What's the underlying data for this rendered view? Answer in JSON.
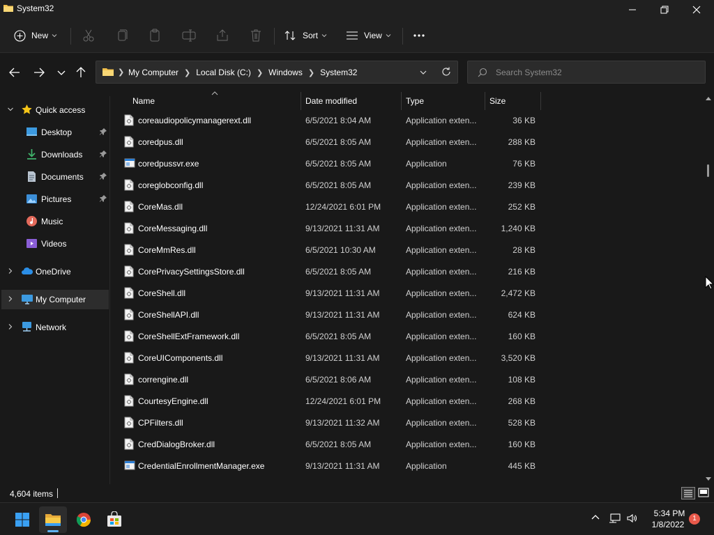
{
  "window": {
    "title": "System32"
  },
  "toolbar": {
    "new_label": "New",
    "sort_label": "Sort",
    "view_label": "View",
    "more_label": "..."
  },
  "address": {
    "crumbs": [
      "My Computer",
      "Local Disk (C:)",
      "Windows",
      "System32"
    ]
  },
  "search": {
    "placeholder": "Search System32"
  },
  "sidebar": {
    "items": [
      {
        "label": "Quick access",
        "icon": "star-icon"
      },
      {
        "label": "Desktop",
        "icon": "desktop-icon",
        "pinned": true
      },
      {
        "label": "Downloads",
        "icon": "download-icon",
        "pinned": true
      },
      {
        "label": "Documents",
        "icon": "documents-icon",
        "pinned": true
      },
      {
        "label": "Pictures",
        "icon": "pictures-icon",
        "pinned": true
      },
      {
        "label": "Music",
        "icon": "music-icon"
      },
      {
        "label": "Videos",
        "icon": "videos-icon"
      },
      {
        "label": "OneDrive",
        "icon": "cloud-icon"
      },
      {
        "label": "My Computer",
        "icon": "computer-icon",
        "selected": true
      },
      {
        "label": "Network",
        "icon": "network-icon"
      }
    ]
  },
  "columns": {
    "name": "Name",
    "date": "Date modified",
    "type": "Type",
    "size": "Size"
  },
  "files": [
    {
      "name": "coreaudiopolicymanagerext.dll",
      "date": "6/5/2021 8:04 AM",
      "type": "Application exten...",
      "size": "36 KB",
      "kind": "dll"
    },
    {
      "name": "coredpus.dll",
      "date": "6/5/2021 8:05 AM",
      "type": "Application exten...",
      "size": "288 KB",
      "kind": "dll"
    },
    {
      "name": "coredpussvr.exe",
      "date": "6/5/2021 8:05 AM",
      "type": "Application",
      "size": "76 KB",
      "kind": "exe"
    },
    {
      "name": "coreglobconfig.dll",
      "date": "6/5/2021 8:05 AM",
      "type": "Application exten...",
      "size": "239 KB",
      "kind": "dll"
    },
    {
      "name": "CoreMas.dll",
      "date": "12/24/2021 6:01 PM",
      "type": "Application exten...",
      "size": "252 KB",
      "kind": "dll"
    },
    {
      "name": "CoreMessaging.dll",
      "date": "9/13/2021 11:31 AM",
      "type": "Application exten...",
      "size": "1,240 KB",
      "kind": "dll"
    },
    {
      "name": "CoreMmRes.dll",
      "date": "6/5/2021 10:30 AM",
      "type": "Application exten...",
      "size": "28 KB",
      "kind": "dll"
    },
    {
      "name": "CorePrivacySettingsStore.dll",
      "date": "6/5/2021 8:05 AM",
      "type": "Application exten...",
      "size": "216 KB",
      "kind": "dll"
    },
    {
      "name": "CoreShell.dll",
      "date": "9/13/2021 11:31 AM",
      "type": "Application exten...",
      "size": "2,472 KB",
      "kind": "dll"
    },
    {
      "name": "CoreShellAPI.dll",
      "date": "9/13/2021 11:31 AM",
      "type": "Application exten...",
      "size": "624 KB",
      "kind": "dll"
    },
    {
      "name": "CoreShellExtFramework.dll",
      "date": "6/5/2021 8:05 AM",
      "type": "Application exten...",
      "size": "160 KB",
      "kind": "dll"
    },
    {
      "name": "CoreUIComponents.dll",
      "date": "9/13/2021 11:31 AM",
      "type": "Application exten...",
      "size": "3,520 KB",
      "kind": "dll"
    },
    {
      "name": "correngine.dll",
      "date": "6/5/2021 8:06 AM",
      "type": "Application exten...",
      "size": "108 KB",
      "kind": "dll"
    },
    {
      "name": "CourtesyEngine.dll",
      "date": "12/24/2021 6:01 PM",
      "type": "Application exten...",
      "size": "268 KB",
      "kind": "dll"
    },
    {
      "name": "CPFilters.dll",
      "date": "9/13/2021 11:32 AM",
      "type": "Application exten...",
      "size": "528 KB",
      "kind": "dll"
    },
    {
      "name": "CredDialogBroker.dll",
      "date": "6/5/2021 8:05 AM",
      "type": "Application exten...",
      "size": "160 KB",
      "kind": "dll"
    },
    {
      "name": "CredentialEnrollmentManager.exe",
      "date": "9/13/2021 11:31 AM",
      "type": "Application",
      "size": "445 KB",
      "kind": "exe"
    }
  ],
  "status": {
    "item_count": "4,604 items"
  },
  "clock": {
    "time": "5:34 PM",
    "date": "1/8/2022"
  },
  "notifications": {
    "count": "1"
  },
  "colors": {
    "accent": "#5fb2f2",
    "folder": "#f3c04c",
    "badge": "#e8594a"
  }
}
